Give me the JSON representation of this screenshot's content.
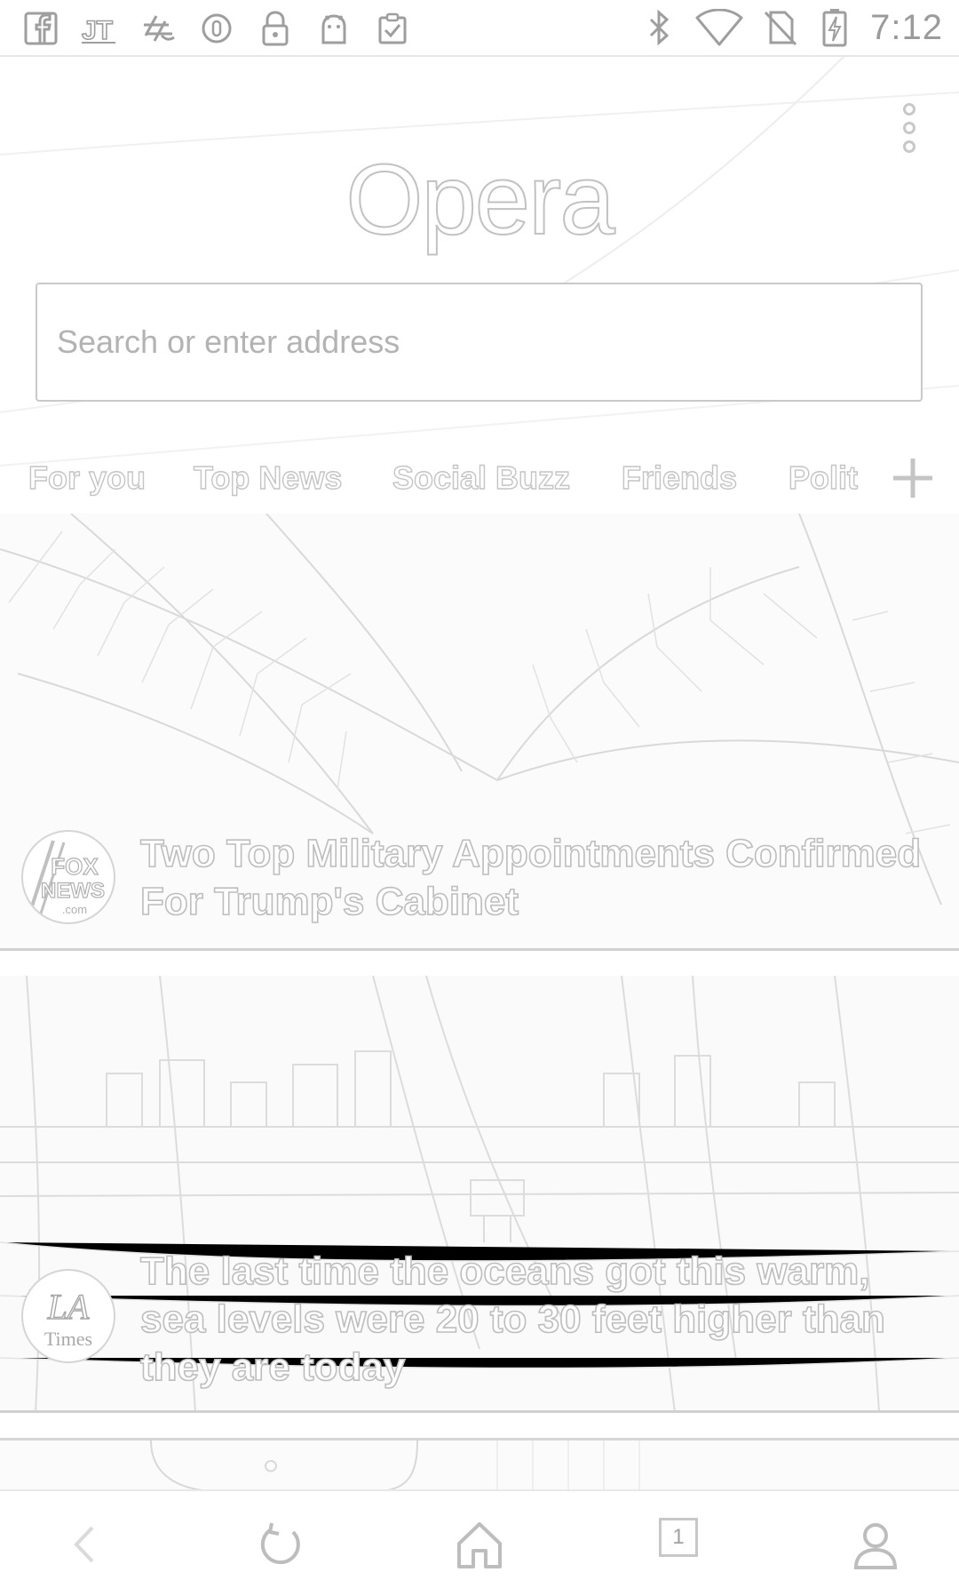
{
  "status_bar": {
    "left_icons": [
      "facebook-icon",
      "jt-app-icon",
      "hashtag-app-icon",
      "circle-app-icon",
      "lock-icon",
      "android-icon",
      "clipboard-check-icon"
    ],
    "right_icons": [
      "bluetooth-icon",
      "wifi-icon",
      "no-sim-icon",
      "battery-charging-icon"
    ],
    "time": "7:12"
  },
  "header": {
    "logo_text": "Opera",
    "search_placeholder": "Search or enter address",
    "menu_icon": "more-vert-icon"
  },
  "tabs": {
    "items": [
      {
        "label": "For you",
        "active": false
      },
      {
        "label": "Top News",
        "active": true
      },
      {
        "label": "Social Buzz",
        "active": false
      },
      {
        "label": "Friends",
        "active": false
      },
      {
        "label": "Polit",
        "active": false
      }
    ],
    "add_icon": "plus-icon"
  },
  "feed": {
    "cards": [
      {
        "source": "Fox News",
        "source_logo_lines": [
          "FOX",
          "NEWS",
          ".com"
        ],
        "title": "Two Top Military Appointments Confirmed For Trump's Cabinet",
        "image": "palm-fronds-photo"
      },
      {
        "source": "LA Times",
        "source_logo_lines": [
          "LA",
          "Times"
        ],
        "title": "The last time the oceans got this warm, sea levels were 20 to 30 feet higher than they are today",
        "image": "beach-skyline-photo"
      },
      {
        "source": "",
        "title": "",
        "image": "partial-photo"
      }
    ]
  },
  "bottom_nav": {
    "back_icon": "back-arrow-icon",
    "refresh_icon": "refresh-icon",
    "home_icon": "home-icon",
    "tab_count": "1",
    "profile_icon": "user-icon"
  }
}
